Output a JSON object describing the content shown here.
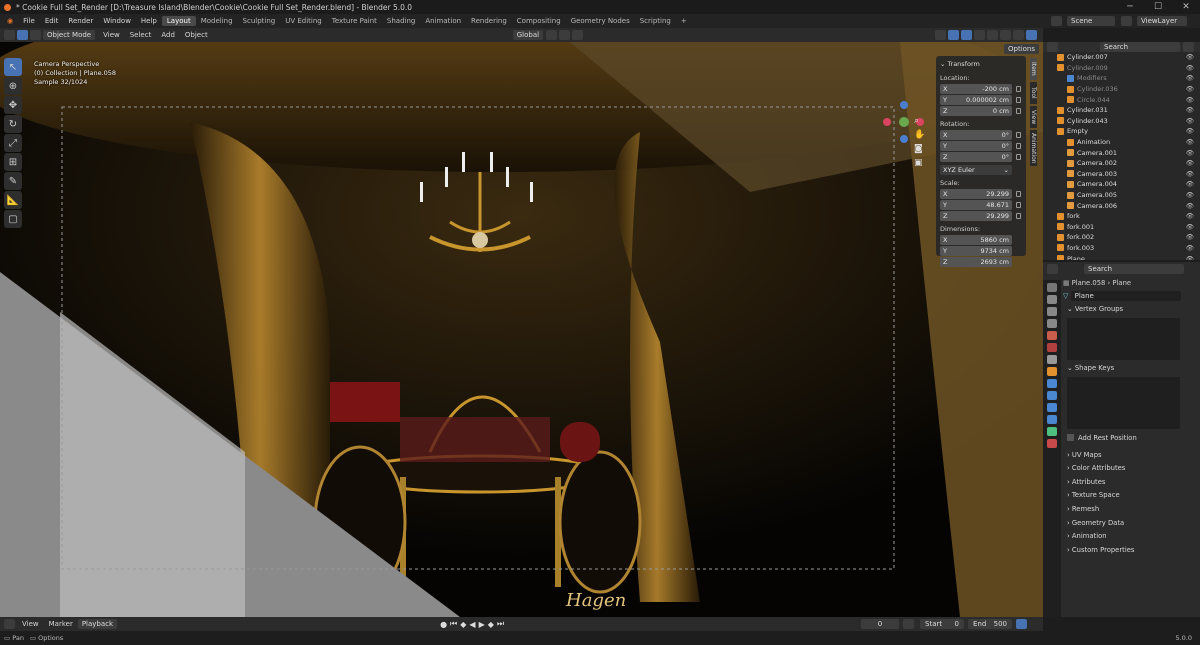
{
  "window": {
    "title": "* Cookie Full Set_Render [D:\\Treasure Island\\Blender\\Cookie\\Cookie Full Set_Render.blend] - Blender 5.0.0",
    "min": "─",
    "max": "☐",
    "close": "✕"
  },
  "menu": [
    "File",
    "Edit",
    "Render",
    "Window",
    "Help"
  ],
  "workspaces": [
    "Layout",
    "Modeling",
    "Sculpting",
    "UV Editing",
    "Texture Paint",
    "Shading",
    "Animation",
    "Rendering",
    "Compositing",
    "Geometry Nodes",
    "Scripting"
  ],
  "workspace_add": "+",
  "scene": {
    "label": "Scene",
    "viewlayer": "ViewLayer"
  },
  "viewport_header": {
    "mode": "Object Mode",
    "menus": [
      "View",
      "Select",
      "Add",
      "Object"
    ],
    "orientation": "Global",
    "options": "Options"
  },
  "overlay": {
    "view_name": "Camera Perspective",
    "collection": "(0) Collection | Plane.058",
    "sample": "Sample 32/1024"
  },
  "signature": "Hagen",
  "npanel": {
    "header": "Transform",
    "tabs": [
      "Item",
      "Tool",
      "View",
      "Animation"
    ],
    "location_label": "Location:",
    "location": [
      {
        "ax": "X",
        "v": "-200 cm"
      },
      {
        "ax": "Y",
        "v": "0.000002 cm"
      },
      {
        "ax": "Z",
        "v": "0 cm"
      }
    ],
    "rotation_label": "Rotation:",
    "rotation": [
      {
        "ax": "X",
        "v": "0°"
      },
      {
        "ax": "Y",
        "v": "0°"
      },
      {
        "ax": "Z",
        "v": "0°"
      }
    ],
    "rotation_mode": "XYZ Euler",
    "scale_label": "Scale:",
    "scale": [
      {
        "ax": "X",
        "v": "29.299"
      },
      {
        "ax": "Y",
        "v": "48.671"
      },
      {
        "ax": "Z",
        "v": "29.299"
      }
    ],
    "dimensions_label": "Dimensions:",
    "dimensions": [
      {
        "ax": "X",
        "v": "5860 cm"
      },
      {
        "ax": "Y",
        "v": "9734 cm"
      },
      {
        "ax": "Z",
        "v": "2693 cm"
      }
    ]
  },
  "outliner": {
    "search": "Search",
    "items": [
      {
        "name": "Cylinder.007",
        "dim": false
      },
      {
        "name": "Cylinder.009",
        "dim": true
      },
      {
        "name": "Modifiers",
        "dim": true
      },
      {
        "name": "Cylinder.036",
        "dim": true
      },
      {
        "name": "Circle.044",
        "dim": true
      },
      {
        "name": "Cylinder.031",
        "dim": false
      },
      {
        "name": "Cylinder.043",
        "dim": false
      },
      {
        "name": "Empty",
        "dim": false
      },
      {
        "name": "Animation",
        "dim": false
      },
      {
        "name": "Camera.001",
        "dim": false
      },
      {
        "name": "Camera.002",
        "dim": false
      },
      {
        "name": "Camera.003",
        "dim": false
      },
      {
        "name": "Camera.004",
        "dim": false
      },
      {
        "name": "Camera.005",
        "dim": false
      },
      {
        "name": "Camera.006",
        "dim": false
      },
      {
        "name": "fork",
        "dim": false
      },
      {
        "name": "fork.001",
        "dim": false
      },
      {
        "name": "fork.002",
        "dim": false
      },
      {
        "name": "fork.003",
        "dim": false
      },
      {
        "name": "Plane",
        "dim": false
      }
    ]
  },
  "properties": {
    "search": "Search",
    "breadcrumb_object": "Plane.058",
    "breadcrumb_data": "Plane",
    "data_name": "Plane",
    "panels": [
      "Vertex Groups",
      "Shape Keys"
    ],
    "add_rest_position": "Add Rest Position",
    "sections": [
      "UV Maps",
      "Color Attributes",
      "Attributes",
      "Texture Space",
      "Remesh",
      "Geometry Data",
      "Animation",
      "Custom Properties"
    ]
  },
  "timeline": {
    "menus": [
      "View",
      "Marker",
      "Playback"
    ],
    "current_frame": "0",
    "start_label": "Start",
    "start": "0",
    "end_label": "End",
    "end": "500"
  },
  "status": {
    "left1": "Pan",
    "left2": "Options",
    "version": "5.0.0"
  },
  "colors": {
    "accent": "#4772b3",
    "gold": "#c9962e",
    "red": "#8e1a1a"
  }
}
